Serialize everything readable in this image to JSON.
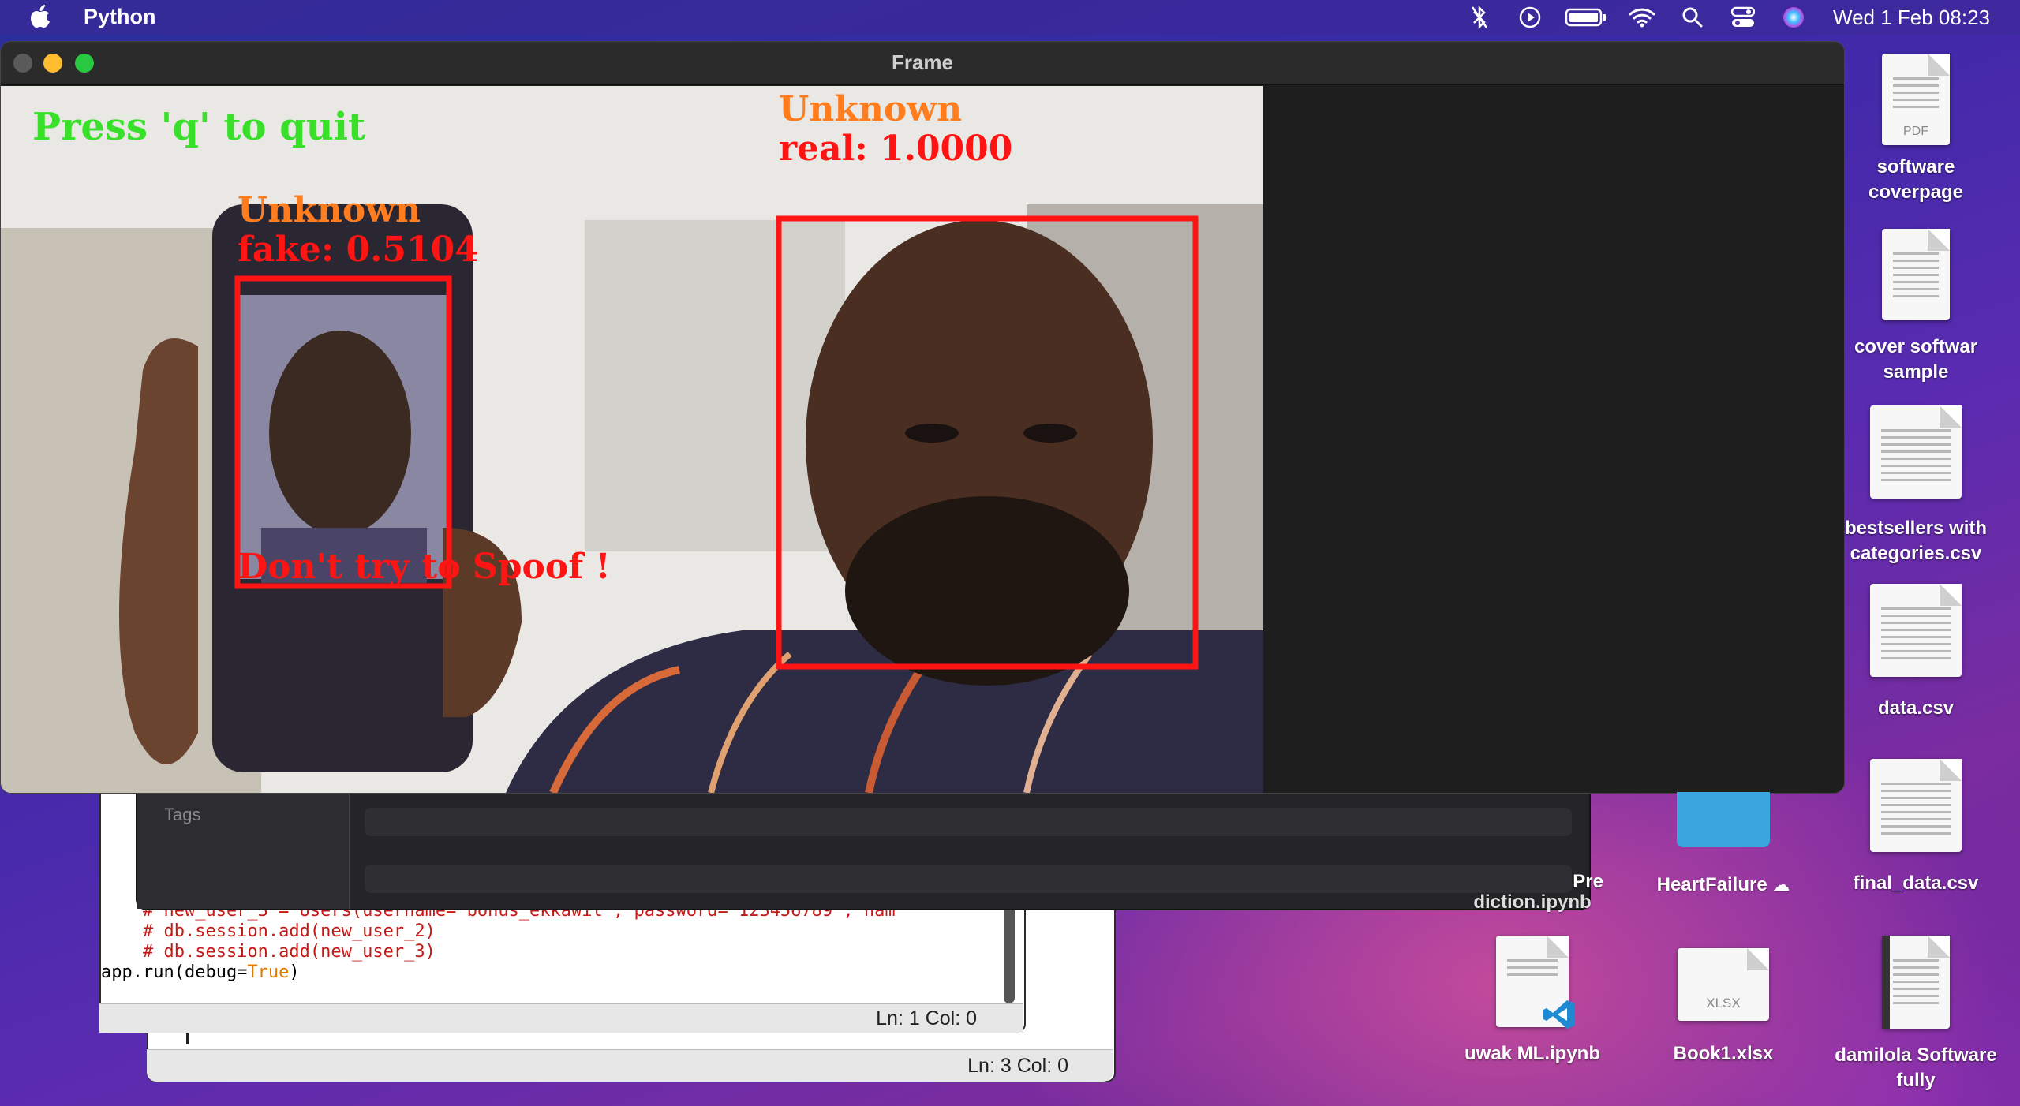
{
  "menubar": {
    "app_name": "Python",
    "clock": "Wed 1 Feb  08:23",
    "icons": [
      "apple-logo",
      "bluetooth-icon",
      "play-icon",
      "battery-icon",
      "wifi-icon",
      "search-icon",
      "control-center-icon",
      "siri-icon"
    ]
  },
  "frame_window": {
    "title": "Frame",
    "overlay": {
      "quit_hint": "Press 'q' to quit",
      "fake_label": "Unknown",
      "fake_score": "fake: 0.5104",
      "spoof_warning": "Don't try to Spoof !",
      "real_label": "Unknown",
      "real_score": "real: 1.0000"
    },
    "colors": {
      "quit_hint": "#38e02a",
      "name": "#ff7d1f",
      "box": "#ff1414"
    }
  },
  "tags_window": {
    "label": "Tags"
  },
  "code_editor": {
    "lines": [
      {
        "text": "    # new_user_3 = Users(username='bonus_ekkawit', password='123456789', nam",
        "type": "comment"
      },
      {
        "text": "    # db.session.add(new_user_2)",
        "type": "comment"
      },
      {
        "text": "    # db.session.add(new_user_3)",
        "type": "comment"
      },
      {
        "text": "",
        "type": "plain"
      }
    ],
    "run_prefix": "app.run(debug=",
    "run_keyword": "True",
    "run_suffix": ")",
    "status": "Ln: 1  Col: 0"
  },
  "back_editor": {
    "status": "Ln: 3  Col: 0"
  },
  "desktop": {
    "icons": [
      {
        "id": "software-coverpage",
        "label_1": "software",
        "label_2": "coverpage",
        "tag": "PDF"
      },
      {
        "id": "cover-softwar-sample",
        "label_1": "cover softwar",
        "label_2": "sample"
      },
      {
        "id": "bestsellers",
        "label_1": "bestsellers with",
        "label_2": "categories.csv"
      },
      {
        "id": "data-csv",
        "label_1": "data.csv"
      },
      {
        "id": "final-data-csv",
        "label_1": "final_data.csv"
      },
      {
        "id": "heartfailure",
        "label_1": "HeartFailure"
      },
      {
        "id": "prediction-ipynb",
        "label_1": "Pre",
        "label_2": "diction.ipynb"
      },
      {
        "id": "uwak-ml",
        "label_1": "uwak ML.ipynb"
      },
      {
        "id": "book1",
        "label_1": "Book1.xlsx",
        "tag": "XLSX"
      },
      {
        "id": "damilola",
        "label_1": "damilola Software",
        "label_2": "fully"
      }
    ]
  }
}
